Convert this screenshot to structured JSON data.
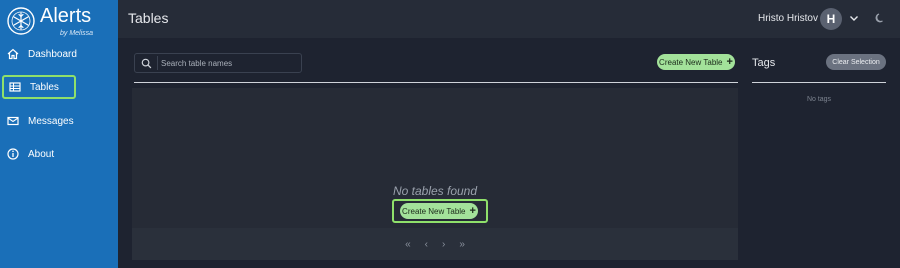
{
  "brand": {
    "title": "Alerts",
    "subtitle": "by Melissa"
  },
  "sidebar": {
    "items": [
      {
        "label": "Dashboard",
        "icon": "home-icon"
      },
      {
        "label": "Tables",
        "icon": "table-icon",
        "active": true
      },
      {
        "label": "Messages",
        "icon": "envelope-icon"
      },
      {
        "label": "About",
        "icon": "info-icon"
      }
    ]
  },
  "header": {
    "title": "Tables",
    "user_name": "Hristo Hristov",
    "avatar_initial": "H"
  },
  "main": {
    "search_placeholder": "Search table names",
    "create_button_label": "Create New Table",
    "empty_message": "No tables found",
    "empty_create_label": "Create New Table",
    "pager": [
      "«",
      "‹",
      "›",
      "»"
    ]
  },
  "tags": {
    "title": "Tags",
    "clear_label": "Clear Selection",
    "empty_message": "No tags"
  },
  "colors": {
    "sidebar": "#1a6fb8",
    "accent_green": "#a3e29a",
    "highlight": "#8fe06b",
    "background": "#1e2330"
  }
}
